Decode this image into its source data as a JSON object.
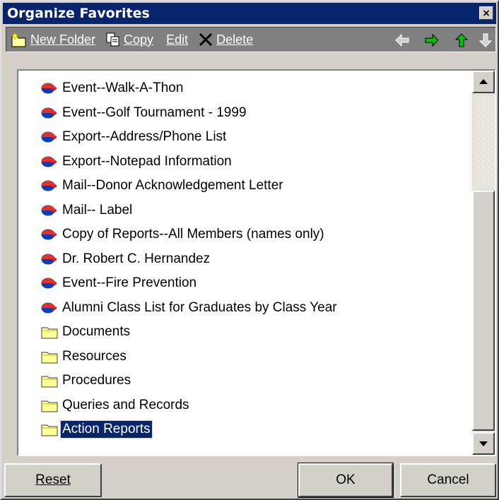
{
  "window": {
    "title": "Organize Favorites",
    "close": "×"
  },
  "toolbar": {
    "new_folder": "New Folder",
    "copy": "Copy",
    "edit": "Edit",
    "delete": "Delete",
    "nav_icons": [
      "left-arrow-icon",
      "right-arrow-icon",
      "up-arrow-icon",
      "down-arrow-icon"
    ]
  },
  "list": {
    "items": [
      {
        "label": "Event--Walk-A-Thon",
        "icon": "report-icon"
      },
      {
        "label": "Event--Golf Tournament - 1999",
        "icon": "report-icon"
      },
      {
        "label": "Export--Address/Phone List",
        "icon": "report-icon"
      },
      {
        "label": "Export--Notepad Information",
        "icon": "report-icon"
      },
      {
        "label": "Mail--Donor Acknowledgement Letter",
        "icon": "report-icon"
      },
      {
        "label": "Mail-- Label",
        "icon": "report-icon"
      },
      {
        "label": "Copy of Reports--All Members (names only)",
        "icon": "report-icon"
      },
      {
        "label": "Dr. Robert C. Hernandez",
        "icon": "report-icon"
      },
      {
        "label": "Event--Fire Prevention",
        "icon": "report-icon"
      },
      {
        "label": "Alumni Class List for Graduates by Class Year",
        "icon": "report-icon"
      },
      {
        "label": "Documents",
        "icon": "folder-icon"
      },
      {
        "label": "Resources",
        "icon": "folder-icon"
      },
      {
        "label": "Procedures",
        "icon": "folder-icon"
      },
      {
        "label": "Queries and Records",
        "icon": "folder-icon"
      },
      {
        "label": "Action Reports",
        "icon": "folder-icon",
        "selected": true
      }
    ]
  },
  "buttons": {
    "reset": "Reset",
    "ok": "OK",
    "cancel": "Cancel"
  },
  "colors": {
    "titlebar": "#08246b",
    "selection": "#08246b",
    "face": "#d4d0c8"
  }
}
